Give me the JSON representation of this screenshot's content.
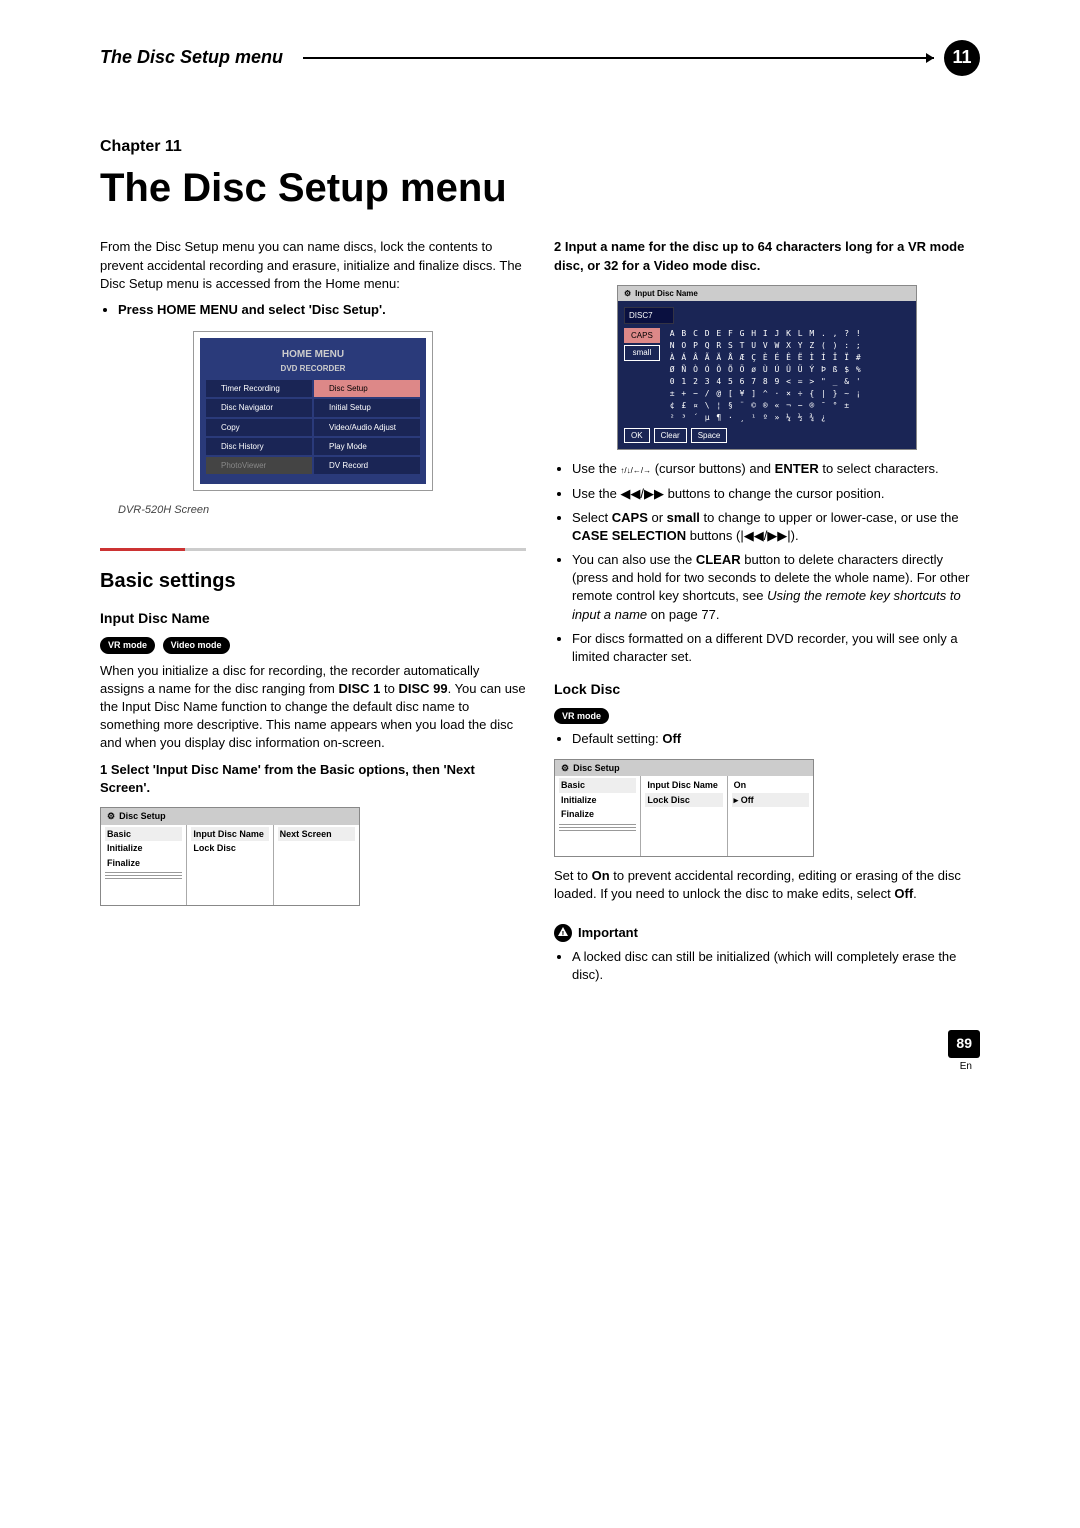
{
  "header": {
    "title": "The Disc Setup menu",
    "badge": "11"
  },
  "chapter_label": "Chapter 11",
  "page_title": "The Disc Setup menu",
  "intro_p1": "From the Disc Setup menu you can name discs, lock the contents to prevent accidental recording and erasure, initialize and finalize discs. The Disc Setup menu is accessed from the Home menu:",
  "intro_step": "Press HOME MENU and select 'Disc Setup'.",
  "home_menu": {
    "title": "HOME MENU",
    "subtitle": "DVD RECORDER",
    "items": [
      "Timer Recording",
      "Disc Setup",
      "Disc Navigator",
      "Initial Setup",
      "Copy",
      "Video/Audio Adjust",
      "Disc History",
      "Play Mode",
      "PhotoViewer",
      "DV Record"
    ]
  },
  "caption": "DVR-520H Screen",
  "section_basic": "Basic settings",
  "input_disc": {
    "heading": "Input Disc Name",
    "badges": [
      "VR mode",
      "Video mode"
    ],
    "p1_a": "When you initialize a disc for recording, the recorder automatically assigns a name for the disc ranging from ",
    "disc1": "DISC 1",
    "p1_b": " to ",
    "disc99": "DISC 99",
    "p1_c": ". You can use the Input Disc Name function to change the default disc name to something more descriptive. This name appears when you load the disc and when you display disc information on-screen.",
    "step1": "1    Select 'Input Disc Name' from the Basic options, then 'Next Screen'."
  },
  "disc_setup1": {
    "title": "Disc Setup",
    "c1": [
      "Basic",
      "Initialize",
      "Finalize"
    ],
    "c2": [
      "Input Disc Name",
      "Lock Disc"
    ],
    "c3": [
      "Next Screen"
    ]
  },
  "right_step2": "2    Input a name for the disc up to 64 characters long for a VR mode disc, or 32 for a Video mode disc.",
  "input_panel": {
    "title": "Input Disc Name",
    "field": "DISC7",
    "side": [
      "CAPS",
      "small"
    ],
    "rows": [
      "A B C D E F G H I J K L M . , ? !",
      "N O P Q R S T U V W X Y Z ( ) : ;",
      "À Á Â Ã Ä Å Æ Ç È É Ê Ë Ì Í Î Ï #",
      "Ø Ñ Ò Ó Ô Õ Ö ø Ù Ú Û Ü Ý Þ ß $ %",
      "0 1 2 3 4 5 6 7 8 9 < = > \" _ & '",
      "± + − / @ [ ¥ ] ^ · × ÷ { | } ~ ¡",
      "¢ £ ¤ \\ ¦ § ¨ © ® « ¬ − ® ¯ ° ±",
      "² ³ ´ µ ¶ · ¸ ¹ º » ¼ ½ ¾ ¿"
    ],
    "bottom": [
      "OK",
      "Clear",
      "Space"
    ]
  },
  "bullets": {
    "b1_a": "Use the ",
    "b1_b": " (cursor buttons) and ",
    "b1_enter": "ENTER",
    "b1_c": " to select characters.",
    "b2": "Use the ◀◀/▶▶ buttons to change the cursor position.",
    "b3_a": "Select ",
    "b3_caps": "CAPS",
    "b3_b": " or ",
    "b3_small": "small",
    "b3_c": " to change to upper or lower-case, or use the ",
    "b3_case": "CASE SELECTION",
    "b3_d": " buttons (|◀◀/▶▶|).",
    "b4_a": "You can also use the ",
    "b4_clear": "CLEAR",
    "b4_b": " button to delete characters directly (press and hold for two seconds to delete the whole name). For other remote control key shortcuts, see ",
    "b4_em": "Using the remote key shortcuts to input a name",
    "b4_c": " on page 77.",
    "b5": "For discs formatted on a different DVD recorder, you will see only a limited character set."
  },
  "lock_disc": {
    "heading": "Lock Disc",
    "badge": "VR mode",
    "default_a": "Default setting: ",
    "default_b": "Off"
  },
  "disc_setup2": {
    "title": "Disc Setup",
    "c1": [
      "Basic",
      "Initialize",
      "Finalize"
    ],
    "c2": [
      "Input Disc Name",
      "Lock Disc"
    ],
    "c3": [
      "On",
      "Off"
    ]
  },
  "lock_p1_a": "Set to ",
  "lock_on": "On",
  "lock_p1_b": " to prevent accidental recording, editing or erasing of the disc loaded. If you need to unlock the disc to make edits, select ",
  "lock_off": "Off",
  "lock_p1_c": ".",
  "important_label": "Important",
  "important_bullet": "A locked disc can still be initialized (which will completely erase the disc).",
  "page_number": "89",
  "page_lang": "En"
}
